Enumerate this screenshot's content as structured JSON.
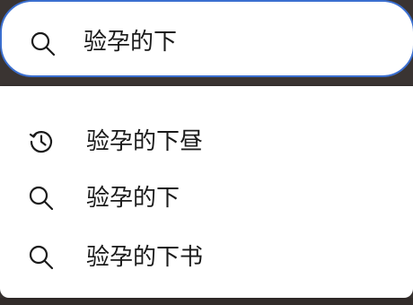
{
  "search": {
    "query": "验孕的下",
    "icon": "search-icon"
  },
  "suggestions": [
    {
      "label": "验孕的下昼",
      "icon": "history-icon"
    },
    {
      "label": "验孕的下",
      "icon": "search-icon"
    },
    {
      "label": "验孕的下书",
      "icon": "search-icon"
    }
  ],
  "colors": {
    "search_border": "#3b6fd0",
    "text": "#1a1a1a",
    "backdrop": "#3a3432"
  }
}
